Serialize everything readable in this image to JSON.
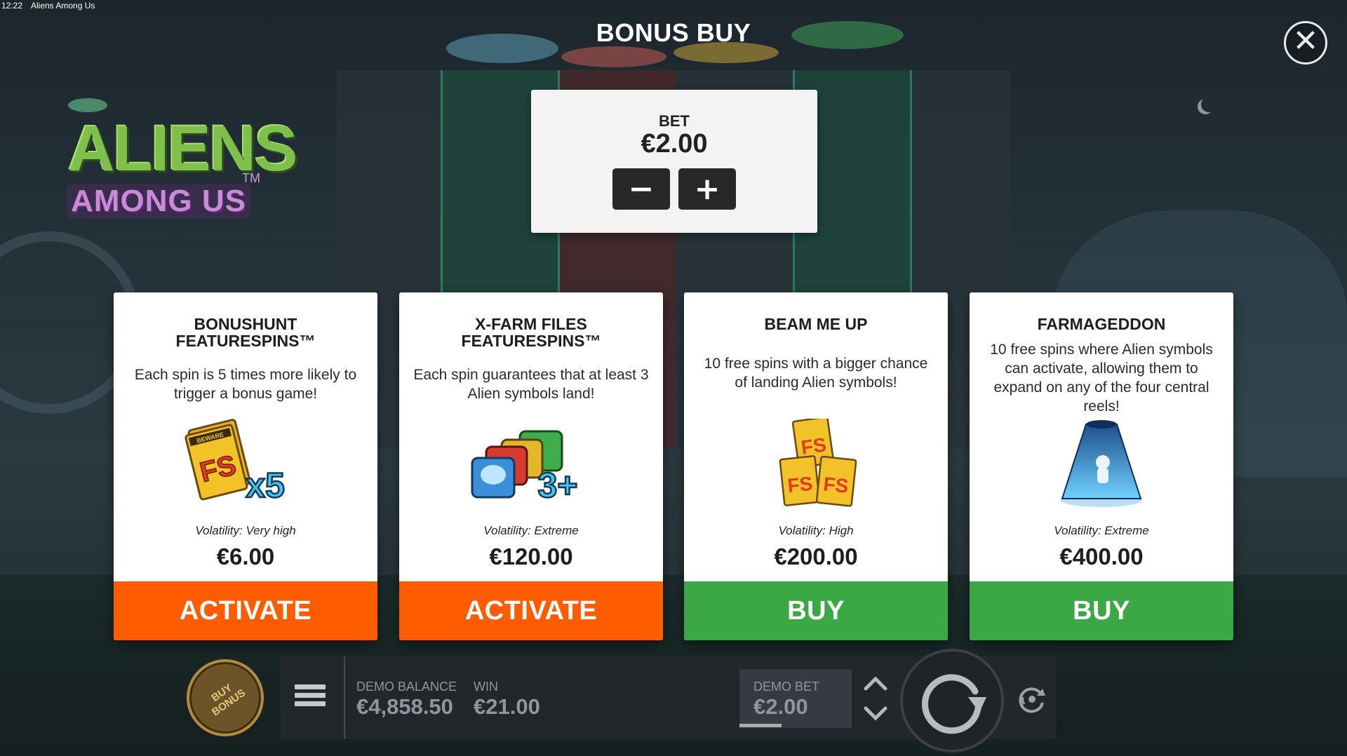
{
  "status_bar": {
    "time": "12:22",
    "title": "Aliens Among Us"
  },
  "logo": {
    "main": "ALIENS",
    "sub": "AMONG US",
    "tm": "TM"
  },
  "header": {
    "title": "BONUS BUY",
    "close_label": "✕"
  },
  "bet": {
    "label": "BET",
    "value": "€2.00",
    "decrease": "−",
    "increase": "+"
  },
  "cards": [
    {
      "title": "BONUSHUNT\nFEATURESPINS™",
      "description": "Each spin is 5 times more likely to trigger a bonus game!",
      "volatility": "Volatility: Very high",
      "price": "€6.00",
      "button": "ACTIVATE",
      "button_color": "#ff5c00",
      "art_icon": "fs-card-x5-icon",
      "art_badge": "x5"
    },
    {
      "title": "X-FARM FILES\nFEATURESPINS™",
      "description": "Each spin guarantees that at least 3 Alien symbols land!",
      "volatility": "Volatility: Extreme",
      "price": "€120.00",
      "button": "ACTIVATE",
      "button_color": "#ff5c00",
      "art_icon": "alien-symbols-3plus-icon",
      "art_badge": "3+"
    },
    {
      "title": "BEAM ME UP",
      "description": "10 free spins with a bigger chance of landing Alien symbols!",
      "volatility": "Volatility: High",
      "price": "€200.00",
      "button": "BUY",
      "button_color": "#3aa845",
      "art_icon": "fs-cards-stack-icon",
      "art_badge": ""
    },
    {
      "title": "FARMAGEDDON",
      "description": "10 free spins where Alien symbols can activate, allowing them to expand on any of the four central reels!",
      "volatility": "Volatility: Extreme",
      "price": "€400.00",
      "button": "BUY",
      "button_color": "#3aa845",
      "art_icon": "tractor-beam-icon",
      "art_badge": ""
    }
  ],
  "card_art_text": {
    "beware": "BEWARE",
    "fs": "FS"
  },
  "bottom_bar": {
    "buy_bonus": "BUY\nBONUS",
    "balance_label": "DEMO BALANCE",
    "balance_value": "€4,858.50",
    "win_label": "WIN",
    "win_value": "€21.00",
    "bet_label": "DEMO BET",
    "bet_value": "€2.00"
  },
  "colors": {
    "activate": "#ff5c00",
    "buy": "#3aa845",
    "panel": "#f3f3f3"
  }
}
